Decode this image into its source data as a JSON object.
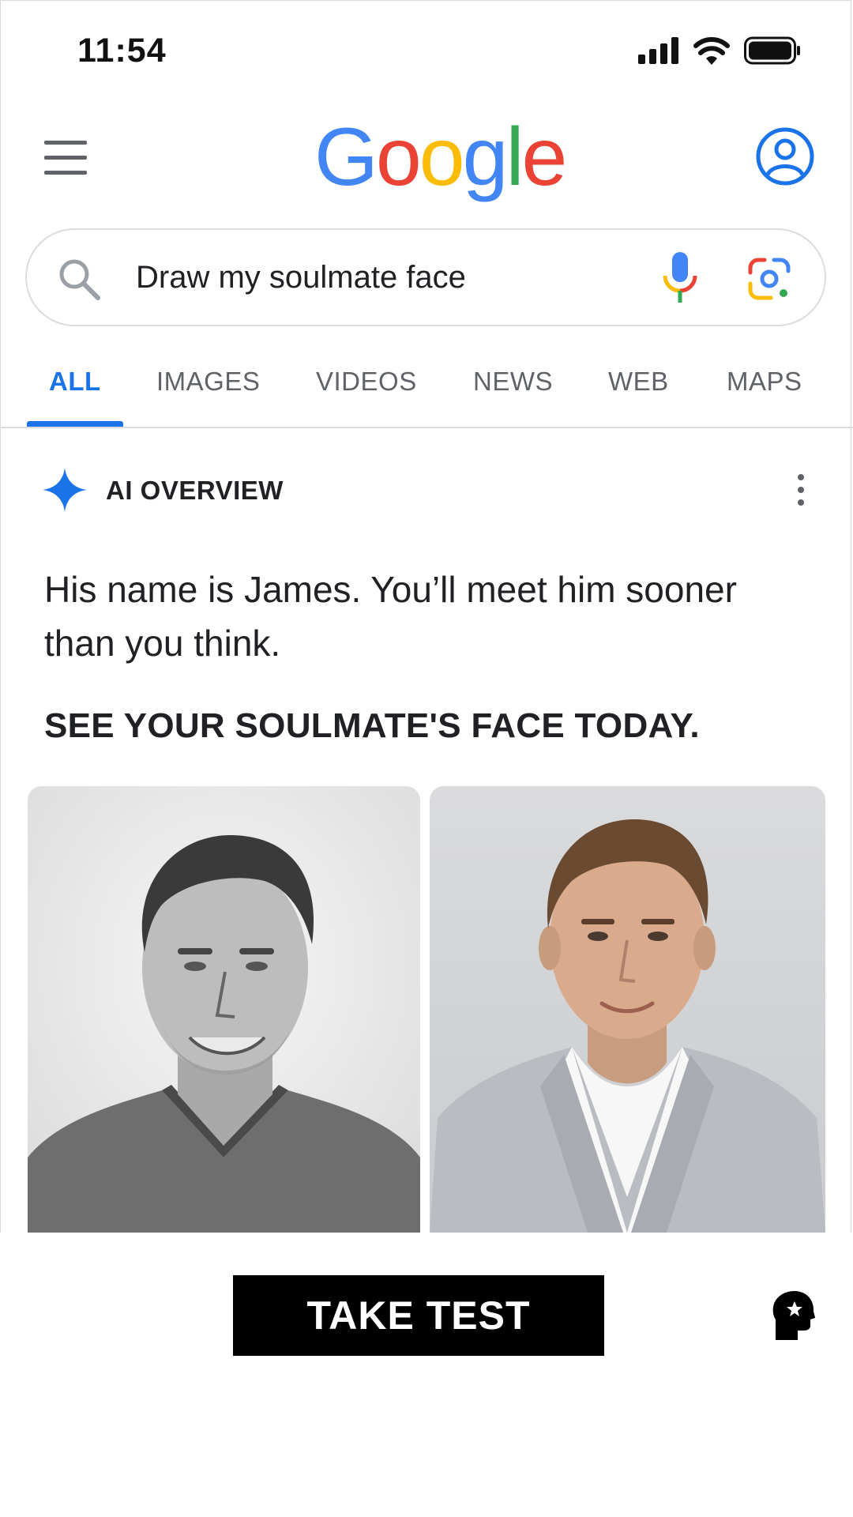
{
  "status_bar": {
    "time": "11:54",
    "icons": [
      "signal-icon",
      "wifi-icon",
      "battery-icon"
    ]
  },
  "header": {
    "logo_letters": [
      {
        "char": "G",
        "color": "#4285F4"
      },
      {
        "char": "o",
        "color": "#EA4335"
      },
      {
        "char": "o",
        "color": "#FBBC05"
      },
      {
        "char": "g",
        "color": "#4285F4"
      },
      {
        "char": "l",
        "color": "#34A853"
      },
      {
        "char": "e",
        "color": "#EA4335"
      }
    ],
    "menu_icon": "hamburger-menu-icon",
    "account_icon": "account-circle-icon"
  },
  "search": {
    "query": "Draw my soulmate face",
    "icons": [
      "search-icon",
      "microphone-icon",
      "google-lens-icon"
    ]
  },
  "tabs": [
    {
      "label": "ALL",
      "active": true
    },
    {
      "label": "IMAGES",
      "active": false
    },
    {
      "label": "VIDEOS",
      "active": false
    },
    {
      "label": "NEWS",
      "active": false
    },
    {
      "label": "WEB",
      "active": false
    },
    {
      "label": "MAPS",
      "active": false
    }
  ],
  "ai_overview": {
    "label": "AI OVERVIEW",
    "icon": "sparkle-icon",
    "text": "His name is James. You’ll meet him sooner than you think.",
    "headline": "SEE YOUR SOULMATE'S FACE TODAY."
  },
  "images": [
    {
      "kind": "pencil-sketch-portrait"
    },
    {
      "kind": "photo-portrait"
    }
  ],
  "cta": {
    "button_label": "TAKE TEST",
    "brand_icon": "head-profile-logo-icon"
  },
  "colors": {
    "accent": "#1a73e8",
    "text": "#202124",
    "muted": "#5f6368",
    "cta_bg": "#000000"
  }
}
